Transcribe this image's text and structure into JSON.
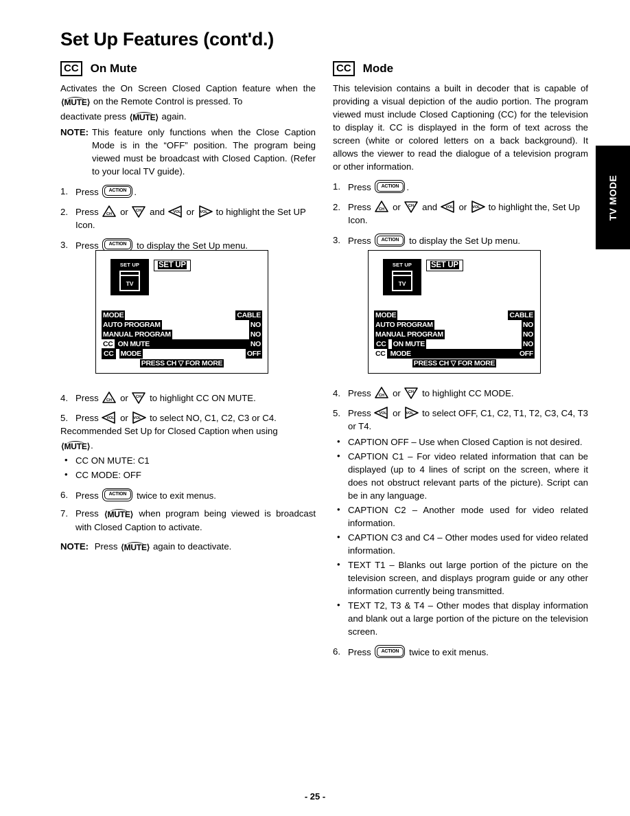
{
  "page": {
    "title": "Set Up Features (cont'd.)",
    "page_number": "- 25 -",
    "side_tab": "TV MODE"
  },
  "glyphs": {
    "action": "ACTION",
    "mute": "MUTE",
    "ch_up": "CH",
    "ch_down": "CH",
    "vol_down": "VOL",
    "vol_up": "VOL"
  },
  "left_column": {
    "badge": "CC",
    "heading": "On Mute",
    "intro_1": "Activates the On Screen Closed Caption feature when",
    "intro_2a": "the",
    "intro_2b": "on the Remote Control is pressed. To",
    "intro_3a": "deactivate press",
    "intro_3b": "again.",
    "note_label": "NOTE:",
    "note_body": "This feature only functions when the Close Caption Mode is in the “OFF” position. The program being viewed must be broadcast with Closed Caption. (Refer to your local TV guide).",
    "steps": {
      "s1_num": "1.",
      "s1_press": "Press",
      "s1_end": ".",
      "s2_num": "2.",
      "s2_press": "Press",
      "s2_or1": "or",
      "s2_and": "and",
      "s2_or2": "or",
      "s2_tail": "to highlight the Set UP Icon.",
      "s3_num": "3.",
      "s3_press": "Press",
      "s3_tail": "to display the Set Up menu.",
      "s4_num": "4.",
      "s4_press": "Press",
      "s4_or": "or",
      "s4_tail": "to highlight CC ON MUTE.",
      "s5_num": "5.",
      "s5_press": "Press",
      "s5_or": "or",
      "s5_tail": "to select NO, C1, C2, C3 or C4.",
      "s5_line2": "Recommended Set Up for Closed Caption when using",
      "s5_line3_end": ".",
      "s6_num": "6.",
      "s6_press": "Press",
      "s6_tail": "twice to exit menus.",
      "s7_num": "7.",
      "s7_press": "Press",
      "s7_tail": "when program being viewed is broadcast with Closed Caption  to activate."
    },
    "bullets": [
      "CC ON MUTE: C1",
      "CC MODE: OFF"
    ],
    "final_note_label": "NOTE:",
    "final_note_a": "Press",
    "final_note_b": "again to deactivate."
  },
  "right_column": {
    "badge": "CC",
    "heading": "Mode",
    "intro": "This television contains a   built in decoder that is capable of providing a visual depiction  of the audio portion. The program viewed   must include Closed Captioning (CC) for the television to display it. CC is displayed in the form of text across the screen (white or colored letters on a back background). It allows the viewer to read the dialogue of a television program or other information.",
    "steps": {
      "s1_num": "1.",
      "s1_press": "Press",
      "s1_end": ".",
      "s2_num": "2.",
      "s2_press": "Press",
      "s2_or1": "or",
      "s2_and": "and",
      "s2_or2": "or",
      "s2_tail": "to highlight the, Set Up Icon.",
      "s3_num": "3.",
      "s3_press": "Press",
      "s3_tail": "to display the Set Up menu.",
      "s4_num": "4.",
      "s4_press": "Press",
      "s4_or": "or",
      "s4_tail": "to highlight CC MODE.",
      "s5_num": "5.",
      "s5_press": "Press",
      "s5_or": "or",
      "s5_tail": "to select OFF, C1, C2, T1, T2, C3, C4, T3 or T4.",
      "s6_num": "6.",
      "s6_press": "Press",
      "s6_tail": "twice to exit menus."
    },
    "bullets": [
      "CAPTION OFF – Use when Closed Caption is not desired.",
      "CAPTION C1 – For video related  information that can be displayed (up to 4 lines of script on the screen, where it does not obstruct relevant parts of the picture). Script can be in any language.",
      "CAPTION C2 – Another mode used  for video related information.",
      "CAPTION C3 and C4 – Other modes used for video related information.",
      "TEXT T1 – Blanks out large portion of the picture on the television screen, and displays program guide or any other information currently being transmitted.",
      "TEXT  T2, T3 & T4 – Other modes that display information and blank out a large portion of the picture on the television screen."
    ]
  },
  "figure_left": {
    "tile_label": "SET UP",
    "tile_tv": "TV",
    "banner": "SET UP",
    "rows": [
      {
        "cc": "",
        "label": "MODE",
        "value": "CABLE",
        "highlight": false
      },
      {
        "cc": "",
        "label": "AUTO PROGRAM",
        "value": "NO",
        "highlight": false
      },
      {
        "cc": "",
        "label": "MANUAL PROGRAM",
        "value": "NO",
        "highlight": false
      },
      {
        "cc": "CC",
        "label": "ON MUTE",
        "value": "NO",
        "highlight": true
      },
      {
        "cc": "CC",
        "label": "MODE",
        "value": "OFF",
        "highlight": false
      }
    ],
    "footer": "PRESS CH ▽ FOR MORE"
  },
  "figure_right": {
    "tile_label": "SET UP",
    "tile_tv": "TV",
    "banner": "SET UP",
    "rows": [
      {
        "cc": "",
        "label": "MODE",
        "value": "CABLE",
        "highlight": false
      },
      {
        "cc": "",
        "label": "AUTO PROGRAM",
        "value": "NO",
        "highlight": false
      },
      {
        "cc": "",
        "label": "MANUAL PROGRAM",
        "value": "NO",
        "highlight": false
      },
      {
        "cc": "CC",
        "label": "ON MUTE",
        "value": "NO",
        "highlight": false
      },
      {
        "cc": "CC",
        "label": "MODE",
        "value": "OFF",
        "highlight": true
      }
    ],
    "footer": "PRESS CH ▽ FOR MORE"
  }
}
